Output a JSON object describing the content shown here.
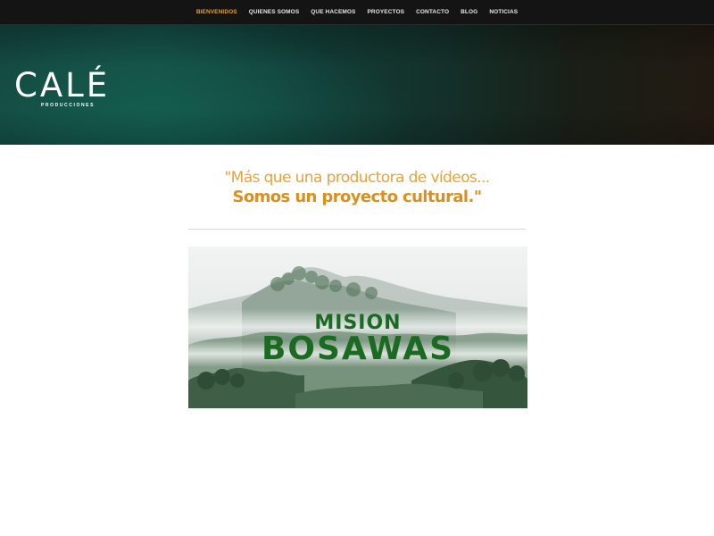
{
  "nav": {
    "items": [
      {
        "label": "BIENVENIDOS",
        "active": true
      },
      {
        "label": "QUIENES SOMOS",
        "active": false
      },
      {
        "label": "QUE HACEMOS",
        "active": false
      },
      {
        "label": "PROYECTOS",
        "active": false
      },
      {
        "label": "CONTACTO",
        "active": false
      },
      {
        "label": "BLOG",
        "active": false
      },
      {
        "label": "NOTICIAS",
        "active": false
      }
    ],
    "active_color": "#e0a030"
  },
  "brand": {
    "name": "CALÉ",
    "subtitle": "PRODUCCIONES"
  },
  "tagline": {
    "line1": "\"Más que una productora de vídeos...",
    "line2": "Somos un proyecto cultural.\"",
    "color": "#e3a032"
  },
  "feature": {
    "title_top": "MISION",
    "title_bottom": "BOSAWAS",
    "title_color": "#1b6a22"
  }
}
